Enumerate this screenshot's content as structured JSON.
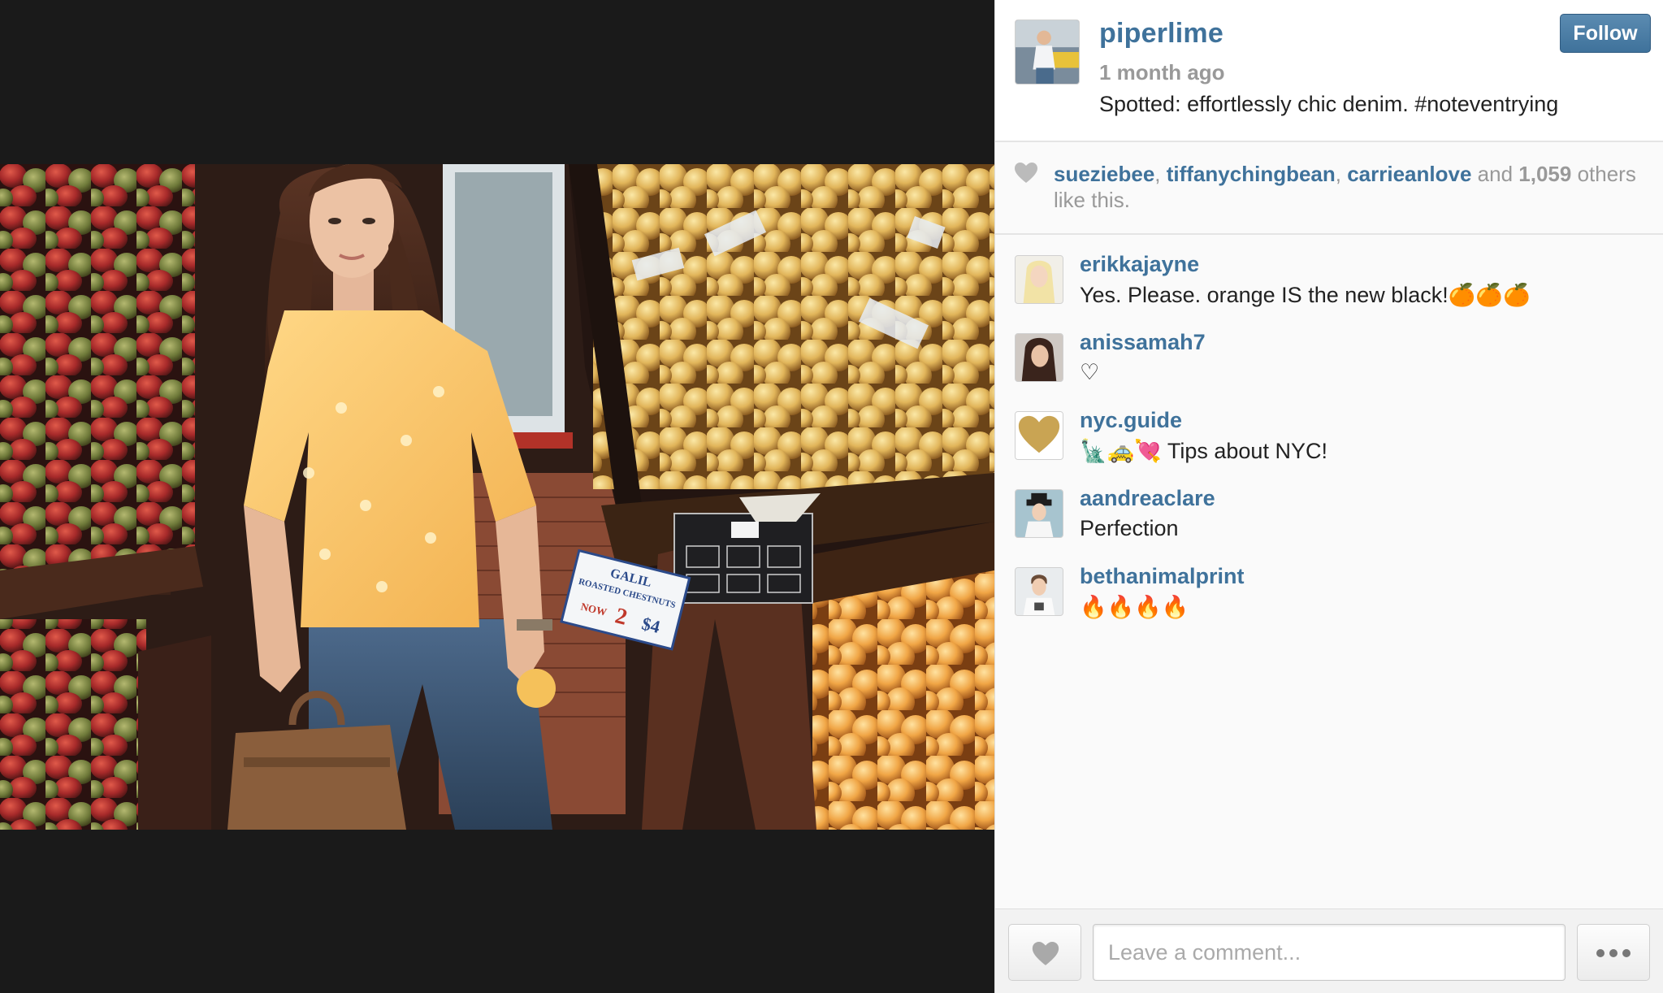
{
  "photo": {
    "label": "Photo of a woman in a yellow top and jeans at a fruit stand",
    "sign_text": [
      "GALIL",
      "ROASTED CHESTNUTS",
      "NOW",
      "2",
      "$4"
    ]
  },
  "post": {
    "owner": "piperlime",
    "time": "1 month ago",
    "caption": "Spotted: effortlessly chic denim. #noteventrying",
    "follow_label": "Follow"
  },
  "likes": {
    "users": [
      "sueziebee",
      "tiffanychingbean",
      "carrieanlove"
    ],
    "sep": ", ",
    "and_text": " and ",
    "count": "1,059",
    "suffix": " others like this."
  },
  "comments": [
    {
      "user": "erikkajayne",
      "text": "Yes. Please. orange IS the new black!🍊🍊🍊"
    },
    {
      "user": "anissamah7",
      "text": "♡"
    },
    {
      "user": "nyc.guide",
      "text": "🗽🚕💘 Tips about NYC!"
    },
    {
      "user": "aandreaclare",
      "text": "Perfection"
    },
    {
      "user": "bethanimalprint",
      "text": "🔥🔥🔥🔥"
    }
  ],
  "footer": {
    "comment_placeholder": "Leave a comment..."
  },
  "colors": {
    "link_blue": "#3f729b",
    "muted_gray": "#999999",
    "media_bg": "#1a1a1a"
  },
  "icons": {
    "like": "heart-icon",
    "more": "ellipsis-icon"
  }
}
